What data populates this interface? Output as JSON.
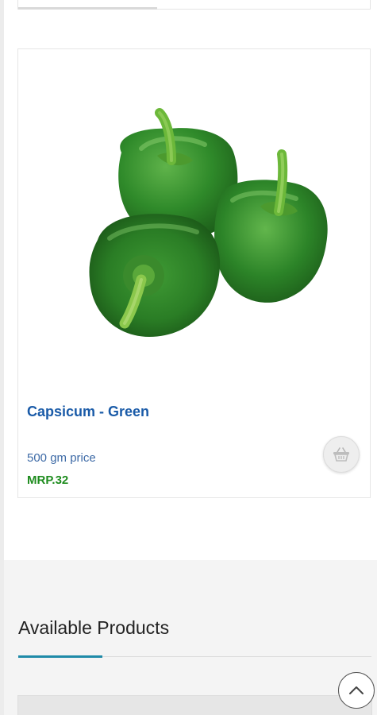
{
  "product": {
    "title": "Capsicum - Green",
    "unit_text": "500 gm price",
    "mrp_text": "MRP.32",
    "image_icon": "green-capsicum-image",
    "add_icon": "basket-icon"
  },
  "section": {
    "title": "Available Products"
  },
  "scroll_top": {
    "icon": "chevron-up-icon"
  },
  "colors": {
    "title": "#1a5ba8",
    "unit": "#3d6aa6",
    "mrp": "#1e8c1e",
    "accent": "#1f8aa8",
    "section_bg": "#f4f4f4"
  }
}
